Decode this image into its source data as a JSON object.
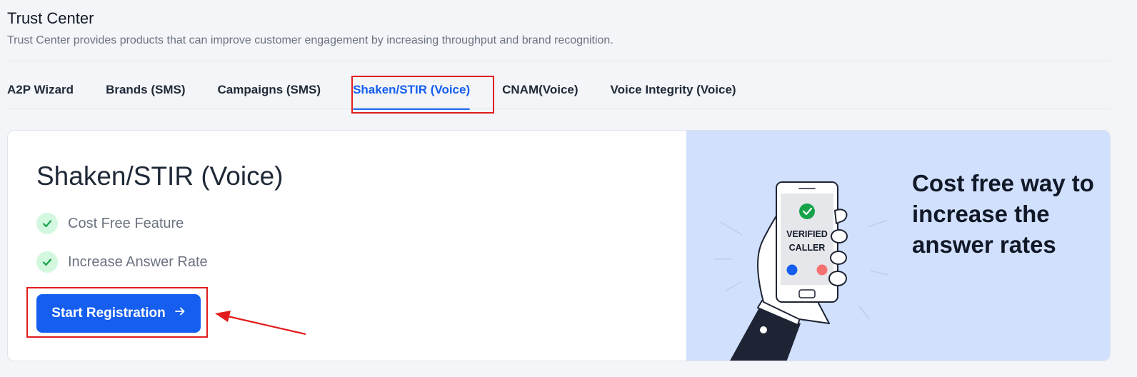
{
  "header": {
    "title": "Trust Center",
    "subtitle": "Trust Center provides products that can improve customer engagement by increasing throughput and brand recognition."
  },
  "tabs": [
    {
      "label": "A2P Wizard",
      "active": false
    },
    {
      "label": "Brands (SMS)",
      "active": false
    },
    {
      "label": "Campaigns (SMS)",
      "active": false
    },
    {
      "label": "Shaken/STIR (Voice)",
      "active": true
    },
    {
      "label": "CNAM(Voice)",
      "active": false
    },
    {
      "label": "Voice Integrity (Voice)",
      "active": false
    }
  ],
  "card": {
    "title": "Shaken/STIR (Voice)",
    "features": [
      "Cost Free Feature",
      "Increase Answer Rate"
    ],
    "cta_label": "Start Registration",
    "cta_icon": "arrow-right-icon",
    "illustration": {
      "verified_line1": "VERIFIED",
      "verified_line2": "CALLER"
    },
    "tagline": "Cost free way to increase the answer rates"
  },
  "colors": {
    "accent": "#155eef",
    "panel_bg": "#d1e0fd",
    "check_green": "#16a34a",
    "annotation_red": "#e11d1d"
  }
}
